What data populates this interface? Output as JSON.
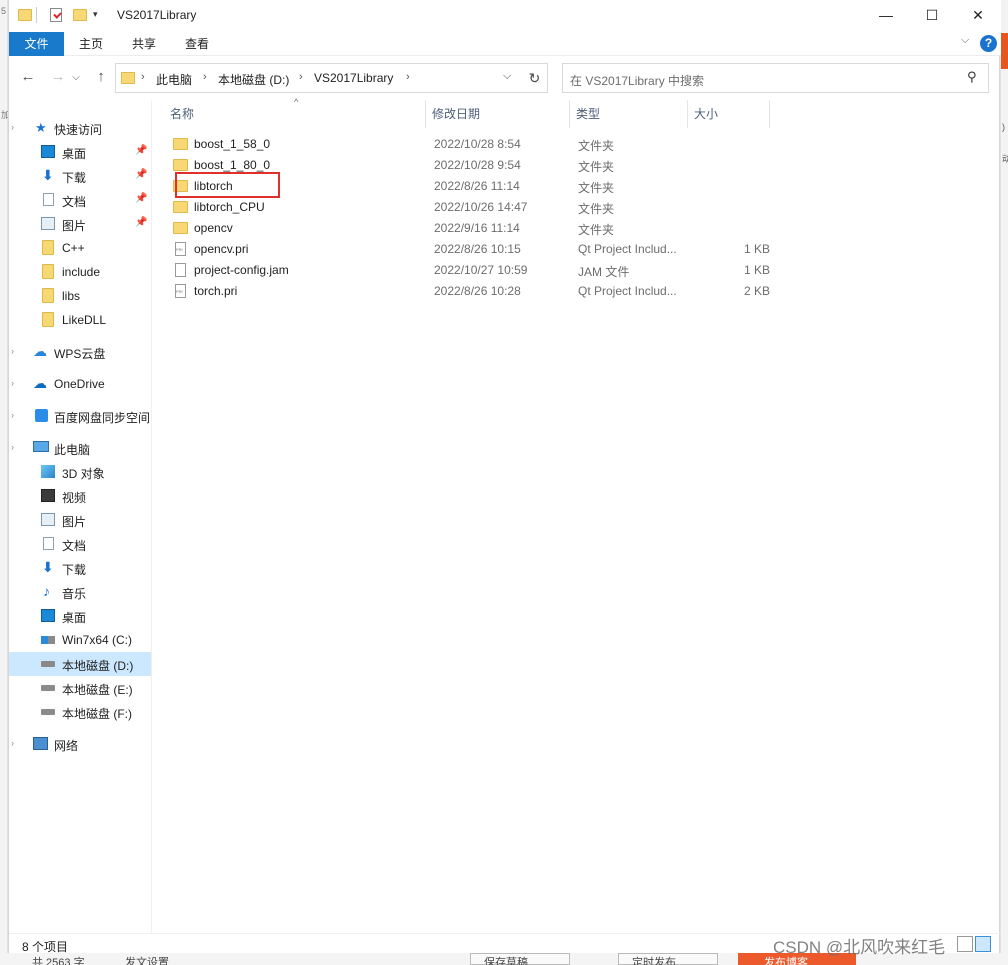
{
  "window": {
    "title": "VS2017Library",
    "qa_dropdown": "▾",
    "controls": {
      "minimize": "—",
      "maximize": "☐",
      "close": "✕"
    }
  },
  "ribbon": {
    "tabs": [
      "文件",
      "主页",
      "共享",
      "查看"
    ],
    "expand": "⌵",
    "help": "?"
  },
  "nav": {
    "back": "←",
    "forward": "→",
    "recent": "⌵",
    "up": "↑",
    "crumbs": [
      "此电脑",
      "本地磁盘 (D:)",
      "VS2017Library"
    ],
    "chevron": "›",
    "address_dropdown": "⌵",
    "refresh": "↻",
    "search_placeholder": "在 VS2017Library 中搜索",
    "search_icon": "⚲"
  },
  "sidebar": {
    "pin": "📌",
    "expander": "›",
    "items": [
      {
        "label": "快速访问",
        "icon": "star-icon"
      },
      {
        "label": "桌面",
        "icon": "desktop-icon",
        "pinned": true
      },
      {
        "label": "下载",
        "icon": "download-icon",
        "pinned": true
      },
      {
        "label": "文档",
        "icon": "document-icon",
        "pinned": true
      },
      {
        "label": "图片",
        "icon": "pictures-icon",
        "pinned": true
      },
      {
        "label": "C++",
        "icon": "folder-icon"
      },
      {
        "label": "include",
        "icon": "folder-icon"
      },
      {
        "label": "libs",
        "icon": "folder-icon"
      },
      {
        "label": "LikeDLL",
        "icon": "folder-icon"
      },
      {
        "label": "WPS云盘",
        "icon": "wps-cloud-icon"
      },
      {
        "label": "OneDrive",
        "icon": "onedrive-icon"
      },
      {
        "label": "百度网盘同步空间",
        "icon": "baidu-netdisk-icon"
      },
      {
        "label": "此电脑",
        "icon": "this-pc-icon"
      },
      {
        "label": "3D 对象",
        "icon": "3d-objects-icon"
      },
      {
        "label": "视频",
        "icon": "videos-icon"
      },
      {
        "label": "图片",
        "icon": "pictures-icon"
      },
      {
        "label": "文档",
        "icon": "document-icon"
      },
      {
        "label": "下载",
        "icon": "download-icon"
      },
      {
        "label": "音乐",
        "icon": "music-icon"
      },
      {
        "label": "桌面",
        "icon": "desktop-icon"
      },
      {
        "label": "Win7x64 (C:)",
        "icon": "system-drive-icon"
      },
      {
        "label": "本地磁盘 (D:)",
        "icon": "drive-icon",
        "selected": true
      },
      {
        "label": "本地磁盘 (E:)",
        "icon": "drive-icon"
      },
      {
        "label": "本地磁盘 (F:)",
        "icon": "drive-icon"
      },
      {
        "label": "网络",
        "icon": "network-icon"
      }
    ]
  },
  "columns": [
    "名称",
    "修改日期",
    "类型",
    "大小"
  ],
  "sort_indicator": "^",
  "files": [
    {
      "name": "boost_1_58_0",
      "date": "2022/10/28 8:54",
      "type": "文件夹",
      "size": "",
      "icon": "folder-icon"
    },
    {
      "name": "boost_1_80_0",
      "date": "2022/10/28 9:54",
      "type": "文件夹",
      "size": "",
      "icon": "folder-icon"
    },
    {
      "name": "libtorch",
      "date": "2022/8/26 11:14",
      "type": "文件夹",
      "size": "",
      "icon": "folder-icon",
      "highlighted": true
    },
    {
      "name": "libtorch_CPU",
      "date": "2022/10/26 14:47",
      "type": "文件夹",
      "size": "",
      "icon": "folder-icon"
    },
    {
      "name": "opencv",
      "date": "2022/9/16 11:14",
      "type": "文件夹",
      "size": "",
      "icon": "folder-icon"
    },
    {
      "name": "opencv.pri",
      "date": "2022/8/26 10:15",
      "type": "Qt Project Includ...",
      "size": "1 KB",
      "icon": "pri-file-icon"
    },
    {
      "name": "project-config.jam",
      "date": "2022/10/27 10:59",
      "type": "JAM 文件",
      "size": "1 KB",
      "icon": "file-icon"
    },
    {
      "name": "torch.pri",
      "date": "2022/8/26 10:28",
      "type": "Qt Project Includ...",
      "size": "2 KB",
      "icon": "pri-file-icon"
    }
  ],
  "status": {
    "item_count": "8 个项目"
  },
  "watermark": "CSDN @北风吹来红毛",
  "background": {
    "bottom_texts": [
      "共 2563 字",
      "发文设置",
      "保存草稿",
      "定时发布",
      "发布博客"
    ],
    "accent": "#e8561f"
  },
  "colors": {
    "accent": "#1979ca",
    "selected": "#cce8ff",
    "highlight": "#e0302a",
    "folder": "#f8d775"
  }
}
